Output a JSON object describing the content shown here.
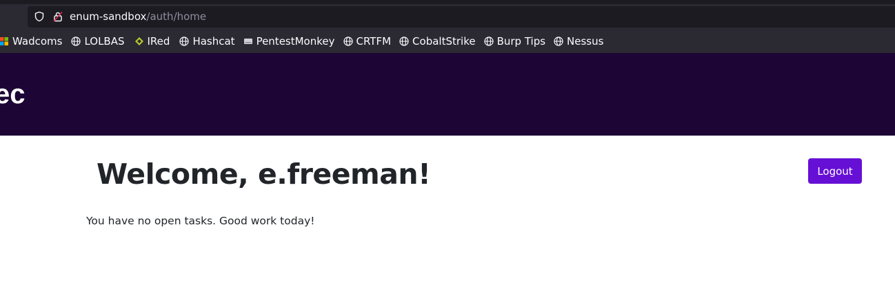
{
  "browser": {
    "url": {
      "host": "enum-sandbox",
      "path": "/auth/home"
    },
    "bookmarks": [
      {
        "label": "Wadcoms",
        "icon": "windows-icon"
      },
      {
        "label": "LOLBAS",
        "icon": "globe-icon"
      },
      {
        "label": "IRed",
        "icon": "diamond-icon"
      },
      {
        "label": "Hashcat",
        "icon": "globe-icon"
      },
      {
        "label": "PentestMonkey",
        "icon": "drive-icon"
      },
      {
        "label": "CRTFM",
        "icon": "globe-icon"
      },
      {
        "label": "CobaltStrike",
        "icon": "globe-icon"
      },
      {
        "label": "Burp Tips",
        "icon": "globe-icon"
      },
      {
        "label": "Nessus",
        "icon": "globe-icon"
      }
    ]
  },
  "header": {
    "brand_fragment": "ec",
    "background": "#1d0535"
  },
  "main": {
    "welcome": "Welcome, e.freeman!",
    "logout_label": "Logout",
    "tasks_message": "You have no open tasks. Good work today!",
    "accent": "#6610d6"
  }
}
